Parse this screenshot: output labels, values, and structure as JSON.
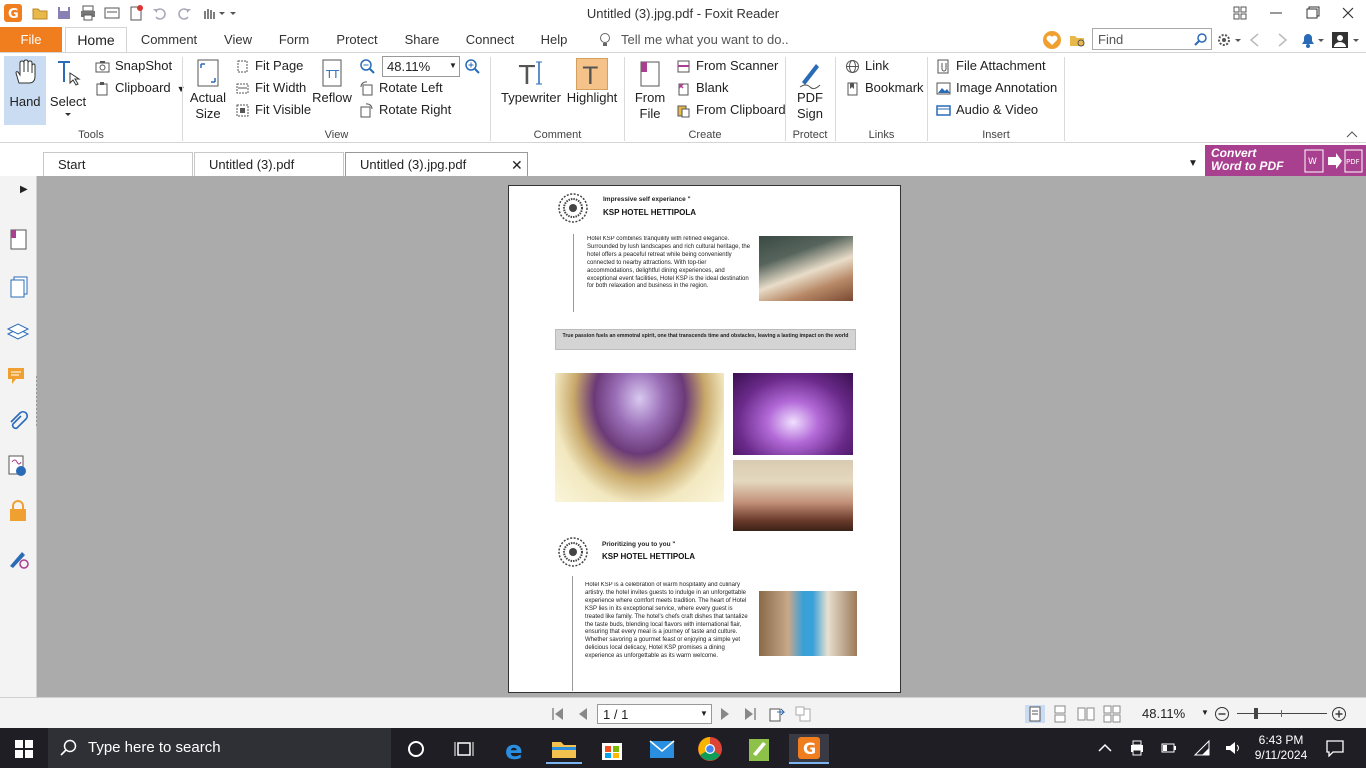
{
  "window": {
    "title": "Untitled (3).jpg.pdf - Foxit Reader",
    "find_placeholder": "Find"
  },
  "menu_tabs": [
    "File",
    "Home",
    "Comment",
    "View",
    "Form",
    "Protect",
    "Share",
    "Connect",
    "Help"
  ],
  "tell_me": "Tell me what you want to do..",
  "ribbon": {
    "tools": {
      "hand": "Hand",
      "select": "Select",
      "snapshot": "SnapShot",
      "clipboard": "Clipboard",
      "group": "Tools"
    },
    "view": {
      "actual_size_1": "Actual",
      "actual_size_2": "Size",
      "fit_page": "Fit Page",
      "fit_width": "Fit Width",
      "fit_visible": "Fit Visible",
      "reflow": "Reflow",
      "zoom_value": "48.11%",
      "rotate_left": "Rotate Left",
      "rotate_right": "Rotate Right",
      "group": "View"
    },
    "comment": {
      "typewriter": "Typewriter",
      "highlight": "Highlight",
      "group": "Comment"
    },
    "create": {
      "from_file_1": "From",
      "from_file_2": "File",
      "from_scanner": "From Scanner",
      "blank": "Blank",
      "from_clipboard": "From Clipboard",
      "group": "Create"
    },
    "protect": {
      "pdf_sign_1": "PDF",
      "pdf_sign_2": "Sign",
      "group": "Protect"
    },
    "links": {
      "link": "Link",
      "bookmark": "Bookmark",
      "group": "Links"
    },
    "insert": {
      "file_attachment": "File Attachment",
      "image_annotation": "Image Annotation",
      "audio_video": "Audio & Video",
      "group": "Insert"
    }
  },
  "doc_tabs": [
    "Start",
    "Untitled (3).pdf",
    "Untitled (3).jpg.pdf"
  ],
  "convert_banner": {
    "line1": "Convert",
    "line2": "Word to PDF"
  },
  "document": {
    "section1": {
      "tagline": "Impressive self experiance \"",
      "hotel": "KSP HOTEL HETTIPOLA",
      "body": "Hotel KSP combines tranquility with refined elegance. Surrounded by lush landscapes and rich cultural heritage, the hotel offers a peaceful retreat while being conveniently connected to nearby attractions. With top-tier accommodations, delightful dining experiences, and exceptional event facilities, Hotel KSP is the ideal destination for both relaxation and business in the region."
    },
    "quote": "True passion fuels an emmotral spirit, one that transcends time and obstacles, leaving a lasting impact on the world",
    "section2": {
      "tagline": "Prioritizing you to you \"",
      "hotel": "KSP HOTEL HETTIPOLA",
      "body": "Hotel KSP is a celebration of warm hospitality and culinary artistry. the hotel invites guests to indulge in an unforgettable experience where comfort meets tradition. The heart of Hotel KSP lies in its exceptional service, where every guest is treated like family. The hotel's chefs craft dishes that tantalize the taste buds, blending local flavors with international flair, ensuring that every meal is a journey of taste and culture. Whether savoring a gourmet feast or enjoying a simple yet delicious local delicacy, Hotel KSP promises a dining experience as unforgettable as its warm welcome."
    }
  },
  "statusbar": {
    "page": "1 / 1",
    "zoom": "48.11%"
  },
  "taskbar": {
    "search": "Type here to search",
    "time": "6:43 PM",
    "date": "9/11/2024"
  },
  "colors": {
    "accent": "#f07e1f",
    "convert_banner": "#a93f8f",
    "canvas": "#ababab"
  }
}
